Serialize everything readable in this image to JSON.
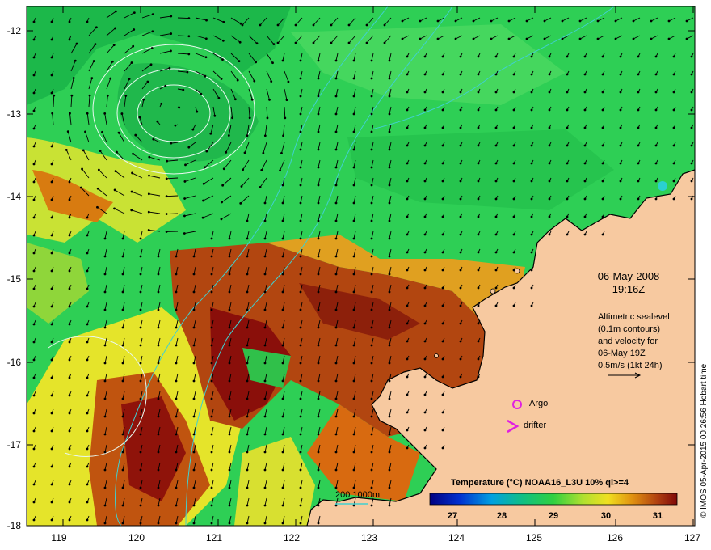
{
  "map": {
    "latitude_ticks": [
      "-12",
      "-13",
      "-14",
      "-15",
      "-16",
      "-17",
      "-18"
    ],
    "longitude_ticks": [
      "119",
      "120",
      "121",
      "122",
      "123",
      "124",
      "125",
      "126",
      "127"
    ],
    "land_color": "#f7c9a0",
    "sst_colors": {
      "cool_green": "#18c24a",
      "mid_green": "#3ad15a",
      "warm_yellow": "#d8e830",
      "hot_orange": "#d87b10",
      "very_hot_brown": "#a33a10",
      "max_red": "#8a0f0a"
    }
  },
  "annotation": {
    "date": "06-May-2008",
    "time": "19:16Z",
    "altimetry_note": [
      "Altimetric sealevel",
      "(0.1m contours)",
      "and velocity for",
      "06-May 19Z",
      "0.5m/s (1kt 24h)"
    ]
  },
  "legend": {
    "argo_label": "Argo",
    "drifter_label": "drifter",
    "argo_color": "#e020e0",
    "drifter_color": "#e020e0",
    "isobath_label": "200  1000m",
    "isobath_color": "#40d0d0"
  },
  "colorbar": {
    "title": "Temperature (°C) NOAA16_L3U 10% ql>=4",
    "ticks": [
      "27",
      "28",
      "29",
      "30",
      "31"
    ],
    "range": [
      26.5,
      31.5
    ]
  },
  "credit": "© IMOS 05-Apr-2015 00:26:56 Hobart time"
}
